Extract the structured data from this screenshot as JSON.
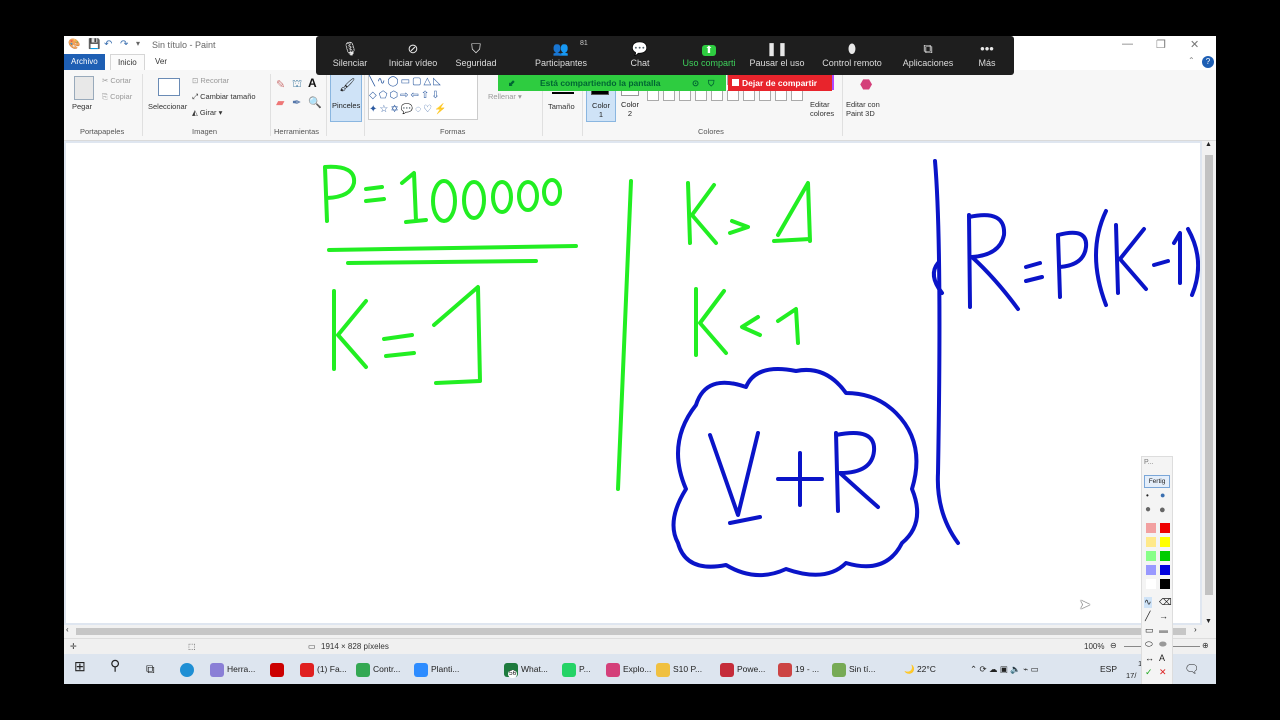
{
  "paint": {
    "window_title": "Sin título - Paint",
    "tabs": [
      "Archivo",
      "Inicio",
      "Ver"
    ],
    "clipboard": {
      "paste": "Pegar",
      "cut": "Cortar",
      "copy": "Copiar",
      "label": "Portapapeles"
    },
    "image": {
      "select": "Seleccionar",
      "crop": "Recortar",
      "resize": "Cambiar tamaño",
      "rotate": "Girar",
      "label": "Imagen"
    },
    "tools_label": "Herramientas",
    "brushes": "Pinceles",
    "shapes": {
      "fill": "Rellenar",
      "label": "Formas"
    },
    "size": "Tamaño",
    "color1": "Color 1",
    "color2": "Color 2",
    "colors_label": "Colores",
    "edit_colors": "Editar colores",
    "paint3d": "Editar con Paint 3D",
    "status_size": "1914 × 828 píxeles",
    "zoom": "100%",
    "palette_colors": [
      "#ffffff",
      "#c3c3c3",
      "#b97a57",
      "#ffaec9",
      "#ffc90e",
      "#efe4b0",
      "#b5e61d",
      "#99d9ea",
      "#7092be",
      "#c8bfe7"
    ]
  },
  "zoom_toolbar": {
    "items": [
      {
        "label": "Silenciar",
        "icon": "microphone-icon"
      },
      {
        "label": "Iniciar vídeo",
        "icon": "video-off-icon"
      },
      {
        "label": "Seguridad",
        "icon": "shield-icon"
      },
      {
        "label": "Participantes",
        "icon": "participants-icon",
        "count": "81"
      },
      {
        "label": "Chat",
        "icon": "chat-icon"
      },
      {
        "label": "Uso comparti",
        "icon": "share-screen-icon"
      },
      {
        "label": "Pausar el uso",
        "icon": "pause-icon"
      },
      {
        "label": "Control remoto",
        "icon": "mouse-icon"
      },
      {
        "label": "Aplicaciones",
        "icon": "apps-icon"
      },
      {
        "label": "Más",
        "icon": "more-icon"
      }
    ],
    "sharing_notice": "Está compartiendo la pantalla",
    "stop_share": "Dejar de compartir"
  },
  "handwriting": {
    "green": [
      "P= 10000",
      "K= 1",
      "K > 1",
      "K < 1"
    ],
    "blue": [
      "V+R",
      "R= P(K-1)"
    ],
    "colors": {
      "green": "#22ee22",
      "blue": "#0a14c8"
    }
  },
  "pen_palette": {
    "title": "P...",
    "done": "Fertig"
  },
  "taskbar": {
    "items": [
      "Herra...",
      "(1) Fa...",
      "Contr...",
      "Planti...",
      "What...",
      "P...",
      "Explo...",
      "S10 P...",
      "Powe...",
      "19 - ...",
      "Sin tí..."
    ],
    "whatsapp_badge": "56",
    "weather": "22°C",
    "language": "ESP",
    "time": "1",
    "date": "17/"
  }
}
